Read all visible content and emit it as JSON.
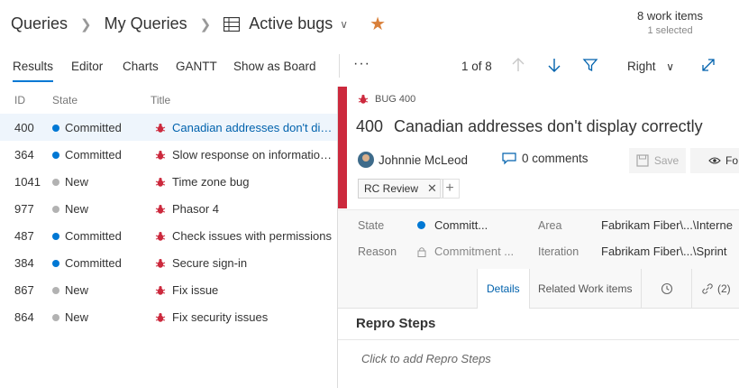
{
  "breadcrumb": {
    "items": [
      "Queries",
      "My Queries",
      "Active bugs"
    ]
  },
  "counts": {
    "items": "8 work items",
    "selected": "1 selected"
  },
  "toolbar": {
    "tabs": [
      "Results",
      "Editor",
      "Charts",
      "GANTT",
      "Show as Board"
    ],
    "active_tab": "Results",
    "more": "···",
    "pager": "1 of 8",
    "pane_position": "Right"
  },
  "list": {
    "headers": [
      "ID",
      "State",
      "Title"
    ],
    "rows": [
      {
        "id": "400",
        "state": "Committed",
        "title": "Canadian addresses don't dis...",
        "state_color": "#0078d4"
      },
      {
        "id": "364",
        "state": "Committed",
        "title": "Slow response on information fo",
        "state_color": "#0078d4"
      },
      {
        "id": "1041",
        "state": "New",
        "title": "Time zone bug",
        "state_color": "#b2b2b2"
      },
      {
        "id": "977",
        "state": "New",
        "title": "Phasor 4",
        "state_color": "#b2b2b2"
      },
      {
        "id": "487",
        "state": "Committed",
        "title": "Check issues with permissions",
        "state_color": "#0078d4"
      },
      {
        "id": "384",
        "state": "Committed",
        "title": "Secure sign-in",
        "state_color": "#0078d4"
      },
      {
        "id": "867",
        "state": "New",
        "title": "Fix issue",
        "state_color": "#b2b2b2"
      },
      {
        "id": "864",
        "state": "New",
        "title": "Fix security issues",
        "state_color": "#b2b2b2"
      }
    ]
  },
  "detail": {
    "type_label": "BUG 400",
    "id": "400",
    "title": "Canadian addresses don't display correctly",
    "assignee": "Johnnie McLeod",
    "comments": "0 comments",
    "save_label": "Save",
    "follow_label": "Fo",
    "tag": "RC Review",
    "fields": {
      "state_label": "State",
      "state_value": "Committ...",
      "reason_label": "Reason",
      "reason_value": "Commitment ...",
      "area_label": "Area",
      "area_value": "Fabrikam Fiber\\...\\Interne",
      "iteration_label": "Iteration",
      "iteration_value": "Fabrikam Fiber\\...\\Sprint"
    },
    "subtabs": {
      "details": "Details",
      "related": "Related Work items",
      "links_count": "(2)"
    },
    "section_title": "Repro Steps",
    "placeholder": "Click to add Repro Steps"
  },
  "colors": {
    "accent": "#0078d4",
    "bug_red": "#cc293d",
    "star": "#d9803a",
    "committed": "#0078d4",
    "new": "#b2b2b2"
  },
  "icons": [
    "chevron-right-icon",
    "grid-icon",
    "chevron-down-icon",
    "star-icon",
    "arrow-up-icon",
    "arrow-down-icon",
    "filter-icon",
    "expand-icon",
    "bug-icon",
    "comment-icon",
    "save-icon",
    "eye-icon",
    "close-icon",
    "plus-icon",
    "lock-icon",
    "history-icon",
    "link-icon"
  ]
}
